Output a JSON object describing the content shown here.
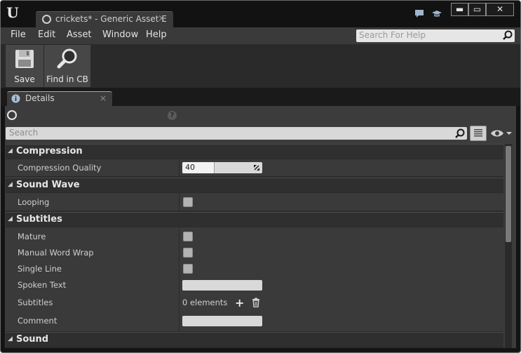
{
  "window": {
    "doc_tab_title": "crickets* - Generic Asset E",
    "doc_tab_close": "×",
    "buttons": {
      "minimize": "▬",
      "maximize": "▭",
      "close": "✕"
    }
  },
  "menu": {
    "items": [
      "File",
      "Edit",
      "Asset",
      "Window",
      "Help"
    ],
    "search_placeholder": "Search For Help"
  },
  "toolbar": {
    "save_label": "Save",
    "find_label": "Find in CB"
  },
  "details": {
    "tab_label": "Details",
    "tab_close": "×",
    "help_glyph": "?",
    "search_placeholder": "Search"
  },
  "categories": {
    "compression": {
      "title": "Compression",
      "props": [
        {
          "name": "Compression Quality",
          "value": "40",
          "level_fraction": 0.4
        }
      ]
    },
    "sound_wave": {
      "title": "Sound Wave",
      "props": [
        {
          "name": "Looping"
        }
      ]
    },
    "subtitles": {
      "title": "Subtitles",
      "props": [
        {
          "name": "Mature"
        },
        {
          "name": "Manual Word Wrap"
        },
        {
          "name": "Single Line"
        },
        {
          "name": "Spoken Text",
          "value": ""
        },
        {
          "name": "Subtitles",
          "value": "0 elements"
        },
        {
          "name": "Comment",
          "value": ""
        }
      ]
    },
    "sound": {
      "title": "Sound"
    }
  },
  "icons": {
    "ue_logo": "unreal-logo-icon",
    "chat": "chat-icon",
    "learn": "learn-cap-icon",
    "save": "floppy-disk-icon",
    "find": "magnifier-icon"
  },
  "colors": {
    "accent_tab_border": "#d9a634",
    "panel_bg": "#3c3c3c",
    "header_bg": "#2f2f2f"
  }
}
